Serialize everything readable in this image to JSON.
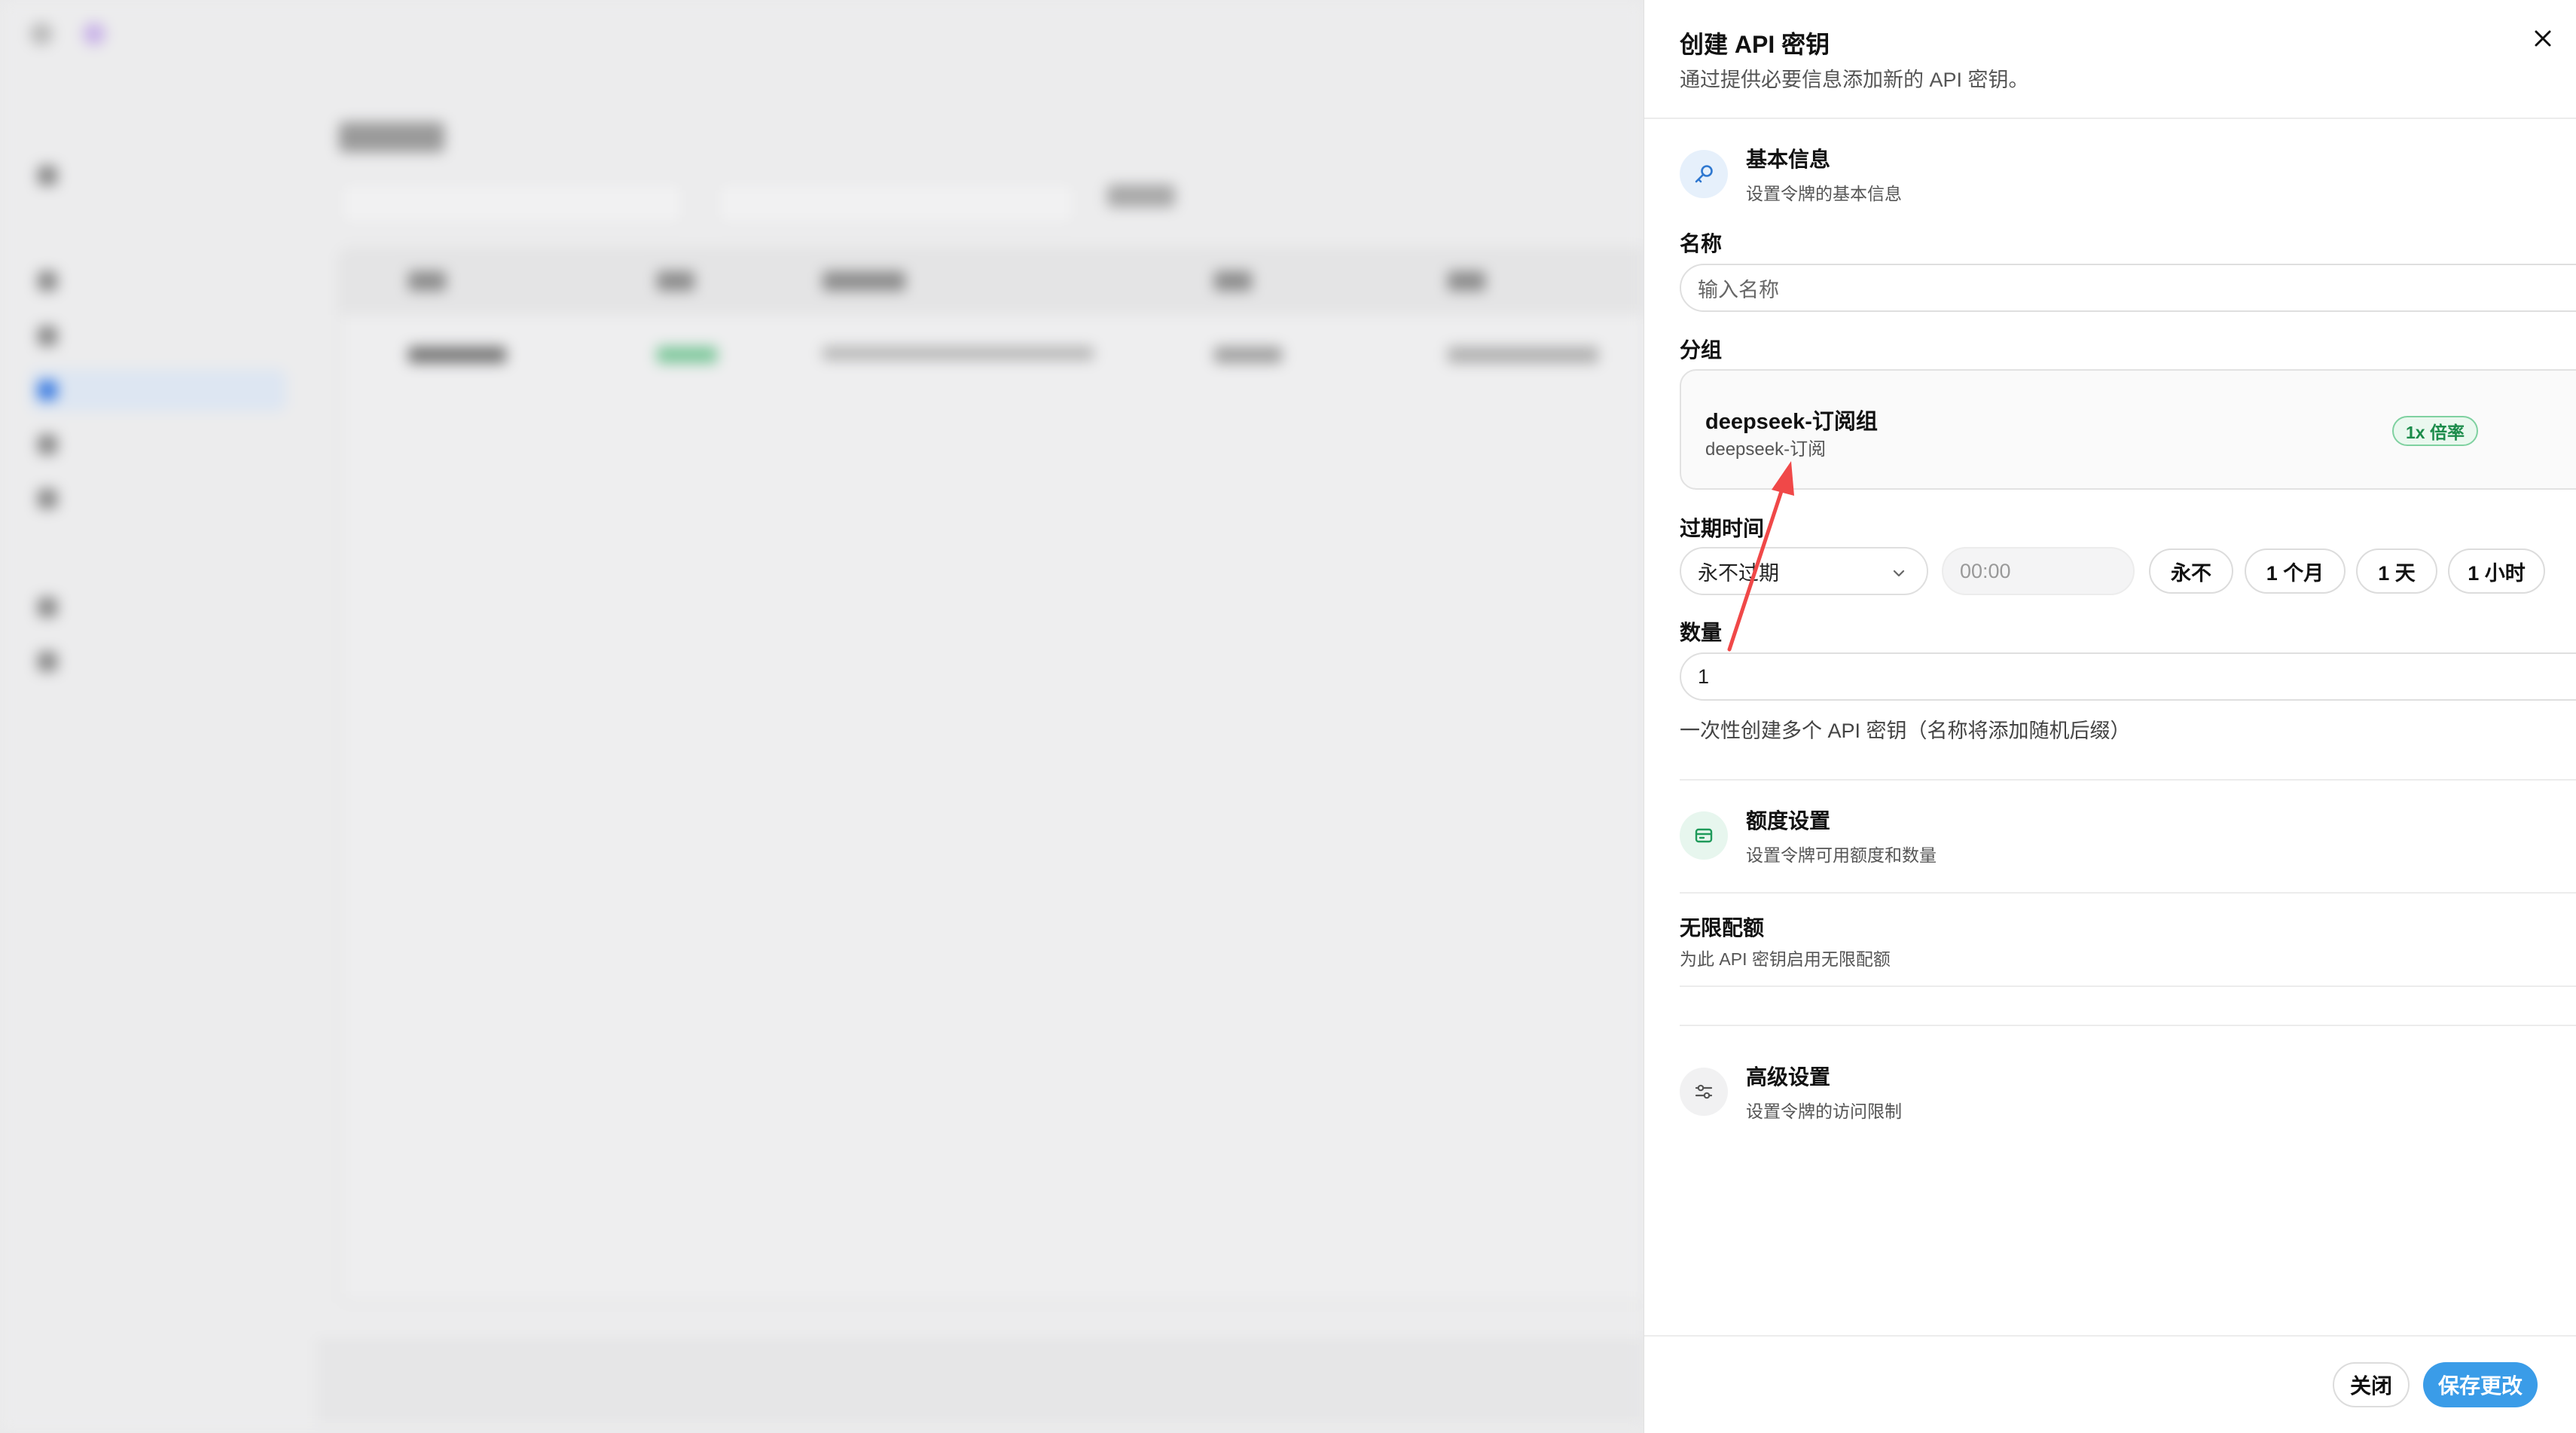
{
  "colors": {
    "accent": "#3a9ce8",
    "toggle_on": "#3a8ee6",
    "badge_green": "#1c8c4b",
    "annotation_arrow": "#f04848"
  },
  "dialog": {
    "title": "创建 API 密钥",
    "subtitle": "通过提供必要信息添加新的 API 密钥。",
    "close_icon": "close-icon",
    "basic": {
      "icon": "key-icon",
      "title": "基本信息",
      "desc": "设置令牌的基本信息"
    },
    "name": {
      "label": "名称",
      "placeholder": "输入名称"
    },
    "group": {
      "label": "分组",
      "selected_name": "deepseek-订阅组",
      "selected_sub": "deepseek-订阅",
      "ratio_badge": "1x 倍率"
    },
    "expiry": {
      "label": "过期时间",
      "selected": "永不过期",
      "time_placeholder": "00:00",
      "quick_options": [
        "永不",
        "1 个月",
        "1 天",
        "1 小时"
      ]
    },
    "quantity": {
      "label": "数量",
      "value": "1",
      "helper": "一次性创建多个 API 密钥（名称将添加随机后缀）"
    },
    "quota": {
      "icon": "wallet-icon",
      "title": "额度设置",
      "desc": "设置令牌可用额度和数量",
      "unlimited_title": "无限配额",
      "unlimited_desc": "为此 API 密钥启用无限配额",
      "unlimited_enabled": true
    },
    "advanced": {
      "icon": "sliders-icon",
      "title": "高级设置",
      "desc": "设置令牌的访问限制"
    },
    "footer": {
      "close_label": "关闭",
      "save_label": "保存更改"
    }
  }
}
